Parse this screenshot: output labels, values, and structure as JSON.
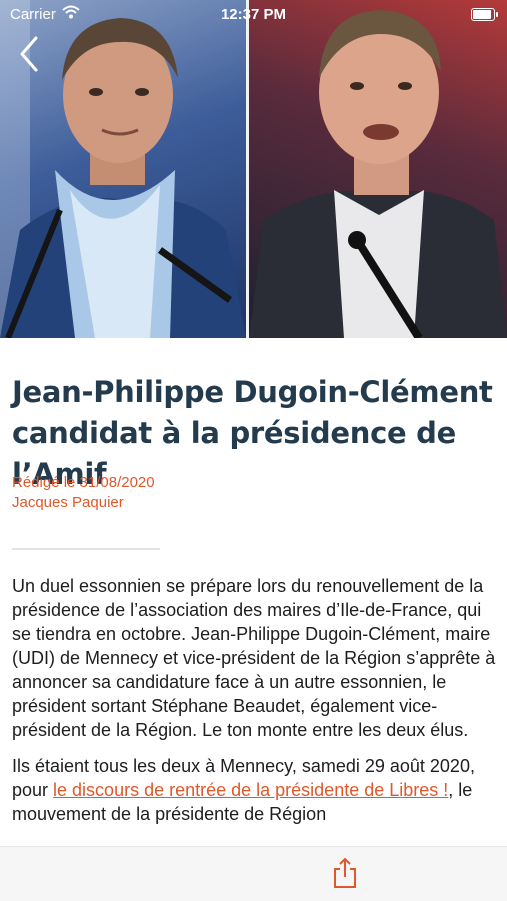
{
  "status_bar": {
    "carrier": "Carrier",
    "time": "12:37 PM"
  },
  "hero": {
    "left_photo": "photo-left",
    "right_photo": "photo-right"
  },
  "article": {
    "title": "Jean-Philippe Dugoin-Clément candidat à la présidence de l’Amif",
    "date": "Rédigé le 31/08/2020",
    "author": "Jacques Paquier",
    "paragraph1": "Un duel essonnien se prépare lors du renouvellement de la présidence de l’association des maires d’Ile-de-France, qui se tiendra en octobre. Jean-Philippe Dugoin-Clément, maire (UDI) de Mennecy et vice-président de la Région s’apprête à annoncer sa candidature face à un autre essonnien, le président sortant Stéphane Beaudet, également vice-président de la Région. Le ton monte entre les deux élus.",
    "paragraph2_before": "Ils étaient tous les deux à Mennecy, samedi 29 août 2020, pour ",
    "paragraph2_link": "le discours de rentrée de la présidente de Libres !",
    "paragraph2_after": ", le mouvement de la présidente de Région"
  },
  "toolbar": {
    "share_icon": "share-icon"
  },
  "colors": {
    "accent": "#e0582b",
    "title": "#243a4d"
  }
}
